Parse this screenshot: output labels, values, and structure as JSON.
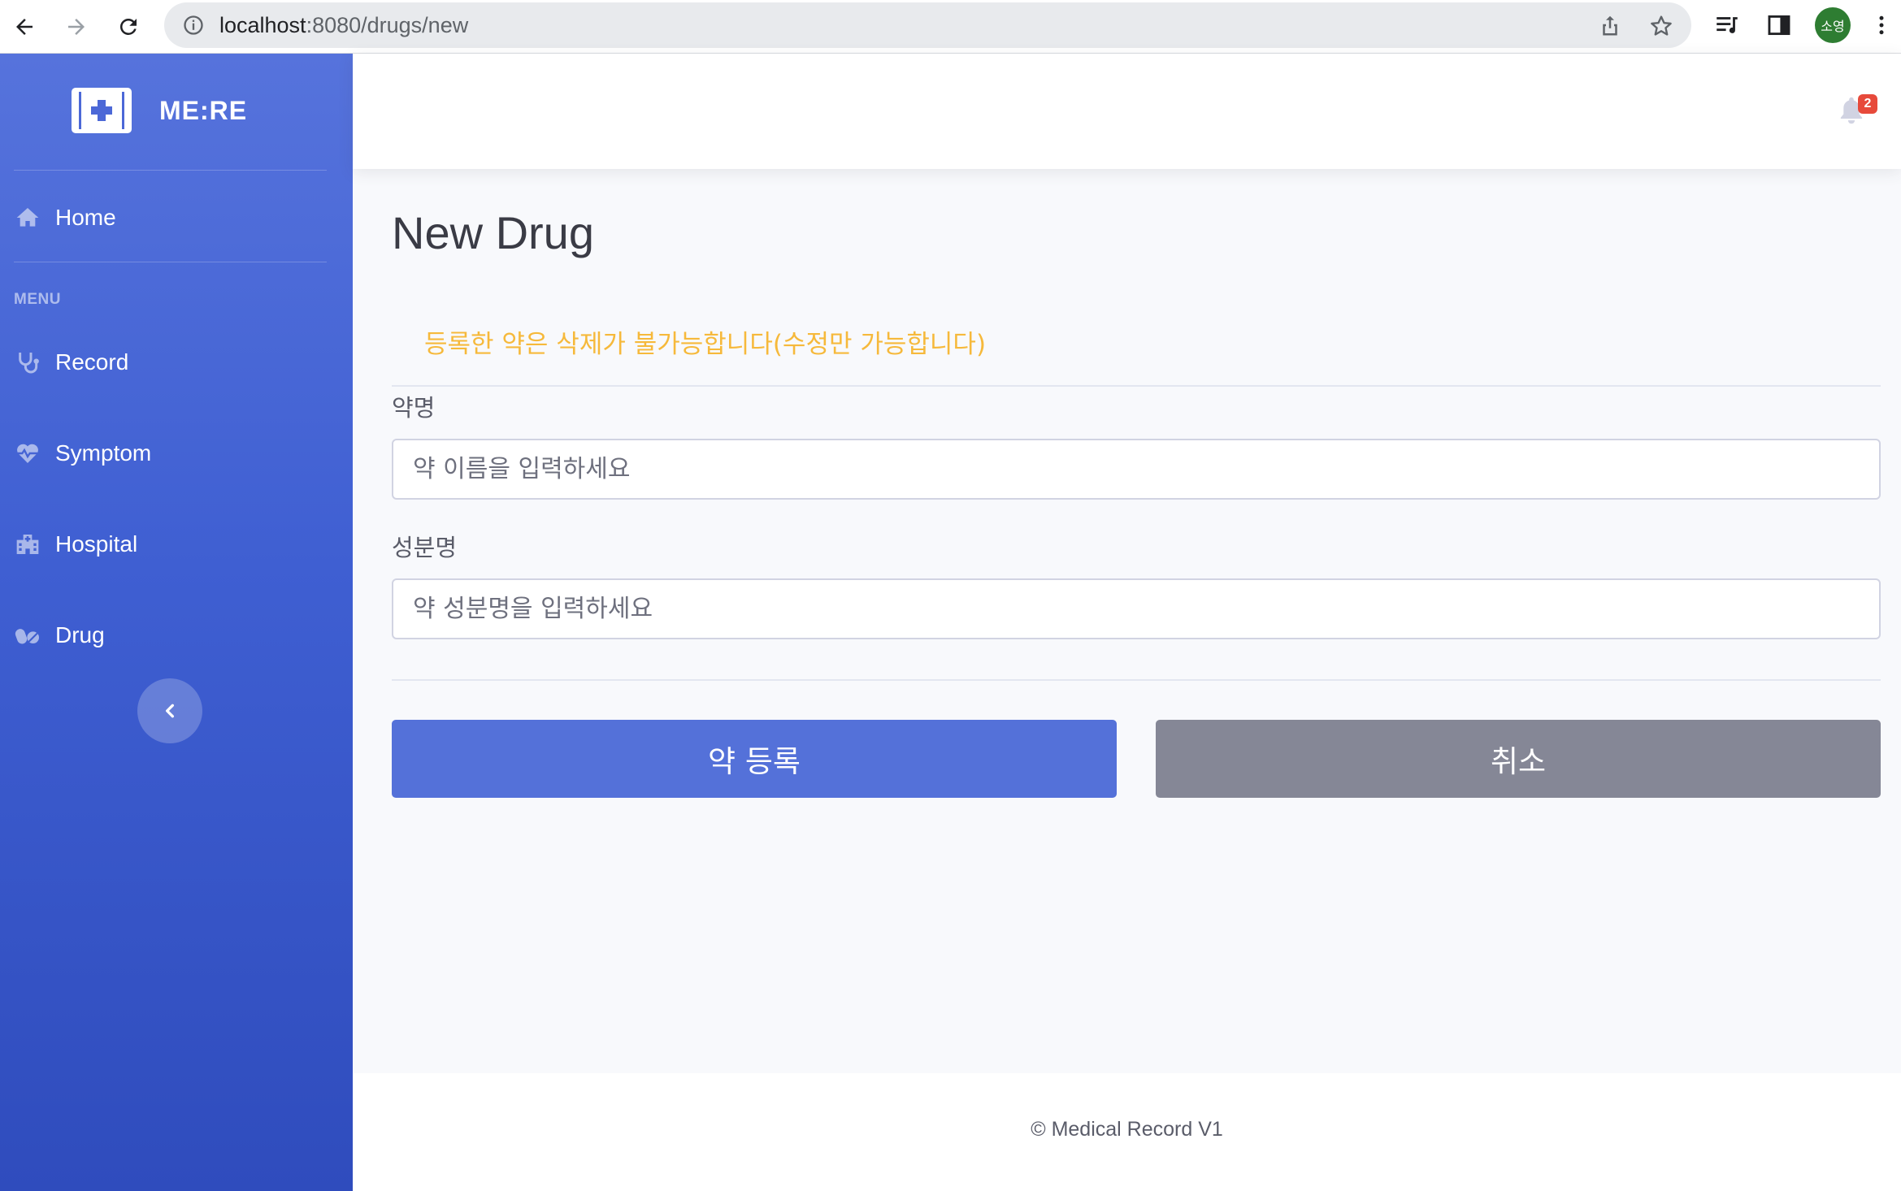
{
  "browser": {
    "url_host": "localhost",
    "url_path": ":8080/drugs/new",
    "profile_initials": "소영"
  },
  "sidebar": {
    "brand": "ME:RE",
    "home_label": "Home",
    "menu_heading": "MENU",
    "items": [
      {
        "label": "Record",
        "icon": "stethoscope-icon"
      },
      {
        "label": "Symptom",
        "icon": "heartbeat-icon"
      },
      {
        "label": "Hospital",
        "icon": "hospital-icon"
      },
      {
        "label": "Drug",
        "icon": "pills-icon"
      }
    ]
  },
  "topbar": {
    "notification_count": "2"
  },
  "main": {
    "title": "New Drug",
    "warning": "등록한 약은 삭제가 불가능합니다(수정만 가능합니다)",
    "drug_name_label": "약명",
    "drug_name_placeholder": "약 이름을 입력하세요",
    "ingredient_label": "성분명",
    "ingredient_placeholder": "약 성분명을 입력하세요",
    "submit_label": "약 등록",
    "cancel_label": "취소"
  },
  "footer": {
    "text": "© Medical Record V1"
  },
  "colors": {
    "sidebar_top": "#5673dc",
    "sidebar_bottom": "#2f4cbd",
    "primary": "#5471d9",
    "secondary": "#858796",
    "warning": "#f6b93b",
    "badge": "#e74a3b"
  }
}
